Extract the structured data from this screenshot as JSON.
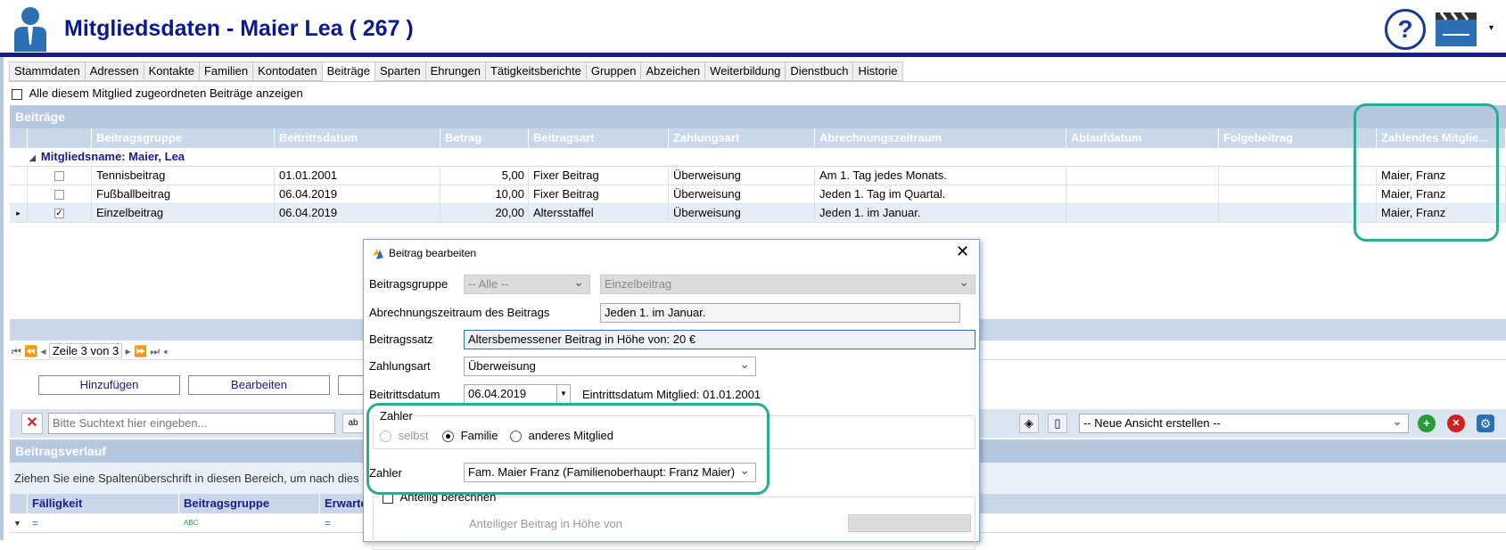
{
  "header": {
    "title": "Mitgliedsdaten - Maier Lea ( 267 )"
  },
  "tabs": [
    "Stammdaten",
    "Adressen",
    "Kontakte",
    "Familien",
    "Kontodaten",
    "Beiträge",
    "Sparten",
    "Ehrungen",
    "Tätigkeitsberichte",
    "Gruppen",
    "Abzeichen",
    "Weiterbildung",
    "Dienstbuch",
    "Historie"
  ],
  "show_all_label": "Alle diesem Mitglied zugeordneten Beiträge anzeigen",
  "beitraege": {
    "section_title": "Beiträge",
    "columns": [
      "Beitragsgruppe",
      "Beitrittsdatum",
      "Betrag",
      "Beitragsart",
      "Zahlungsart",
      "Abrechnungszeitraum",
      "Ablaufdatum",
      "Folgebeitrag",
      "Zahlendes Mitglie..."
    ],
    "group_label": "Mitgliedsname: Maier, Lea",
    "rows": [
      {
        "gruppe": "Tennisbeitrag",
        "datum": "01.01.2001",
        "betrag": "5,00",
        "art": "Fixer Beitrag",
        "zahlungsart": "Überweisung",
        "zeitraum": "Am 1. Tag jedes Monats.",
        "ablauf": "",
        "folge": "",
        "zahler": "Maier, Franz",
        "checked": false
      },
      {
        "gruppe": "Fußballbeitrag",
        "datum": "06.04.2019",
        "betrag": "10,00",
        "art": "Fixer Beitrag",
        "zahlungsart": "Überweisung",
        "zeitraum": "Jeden 1. Tag im Quartal.",
        "ablauf": "",
        "folge": "",
        "zahler": "Maier, Franz",
        "checked": false
      },
      {
        "gruppe": "Einzelbeitrag",
        "datum": "06.04.2019",
        "betrag": "20,00",
        "art": "Altersstaffel",
        "zahlungsart": "Überweisung",
        "zeitraum": "Jeden 1. im Januar.",
        "ablauf": "",
        "folge": "",
        "zahler": "Maier, Franz",
        "checked": true
      }
    ],
    "pager": "Zeile 3 von 3",
    "add_btn": "Hinzufügen",
    "edit_btn": "Bearbeiten"
  },
  "search": {
    "placeholder": "Bitte Suchtext hier eingeben..."
  },
  "view_select": "-- Neue Ansicht erstellen --",
  "verlauf": {
    "section_title": "Beitragsverlauf",
    "hint": "Ziehen Sie eine Spaltenüberschrift in diesen Bereich, um nach dies",
    "columns": [
      "Fälligkeit",
      "Beitragsgruppe",
      "Erwartet"
    ]
  },
  "dialog": {
    "title": "Beitrag bearbeiten",
    "lbl_gruppe": "Beitragsgruppe",
    "gruppe_filter": "-- Alle --",
    "gruppe_value": "Einzelbeitrag",
    "lbl_zeitraum": "Abrechnungszeitraum des Beitrags",
    "zeitraum_value": "Jeden 1. im Januar.",
    "lbl_satz": "Beitragssatz",
    "satz_value": "Altersbemessener Beitrag in Höhe von: 20 €",
    "lbl_zahlungsart": "Zahlungsart",
    "zahlungsart_value": "Überweisung",
    "lbl_beitritt": "Beitrittsdatum",
    "beitritt_value": "06.04.2019",
    "eintritt_info": "Eintrittsdatum Mitglied: 01.01.2001",
    "zahler_group": "Zahler",
    "opt_selbst": "selbst",
    "opt_familie": "Familie",
    "opt_anderes": "anderes Mitglied",
    "lbl_zahler": "Zahler",
    "zahler_value": "Fam. Maier Franz (Familienoberhaupt: Franz Maier)",
    "anteilig_label": "Anteilig berechnen",
    "anteilig_betrag_label": "Anteiliger Beitrag in Höhe von"
  }
}
